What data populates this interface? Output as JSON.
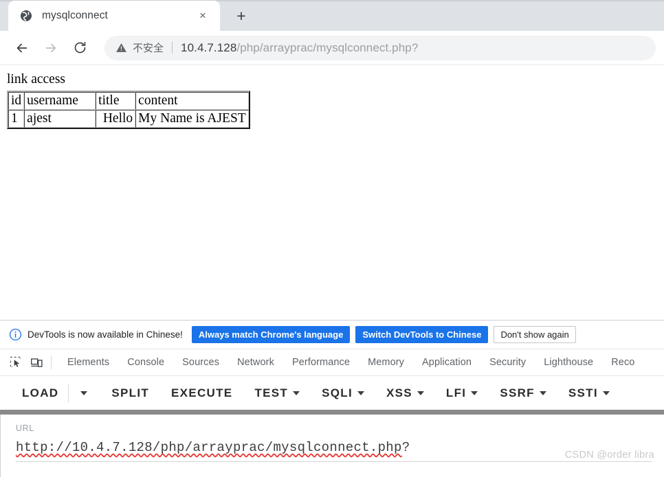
{
  "browser": {
    "tab": {
      "title": "mysqlconnect",
      "favicon": "globe-icon",
      "close_label": "×"
    },
    "newtab_label": "+",
    "nav": {
      "back": "←",
      "forward": "→",
      "reload": "reload-icon"
    },
    "omnibox": {
      "security_icon": "warning-triangle-icon",
      "security_label": "不安全",
      "url_host": "10.4.7.128",
      "url_path": "/php/arrayprac/mysqlconnect.php?"
    }
  },
  "page": {
    "heading": "link access",
    "table": {
      "headers": [
        "id",
        "username",
        "title",
        "content"
      ],
      "rows": [
        [
          "1",
          "ajest",
          "Hello",
          "My Name is AJEST"
        ]
      ]
    }
  },
  "devtools": {
    "notice": {
      "icon": "info-circle-icon",
      "text": "DevTools is now available in Chinese!",
      "buttons": [
        {
          "label": "Always match Chrome's language",
          "style": "primary"
        },
        {
          "label": "Switch DevTools to Chinese",
          "style": "primary"
        },
        {
          "label": "Don't show again",
          "style": "secondary"
        }
      ]
    },
    "icons": {
      "inspect": "inspect-element-icon",
      "device": "device-toolbar-icon"
    },
    "tabs": [
      "Elements",
      "Console",
      "Sources",
      "Network",
      "Performance",
      "Memory",
      "Application",
      "Security",
      "Lighthouse",
      "Reco"
    ]
  },
  "hackbar": {
    "toolbar": [
      {
        "label": "LOAD",
        "caret": false
      },
      {
        "label": "SPLIT",
        "caret": false
      },
      {
        "label": "EXECUTE",
        "caret": false
      },
      {
        "label": "TEST",
        "caret": true
      },
      {
        "label": "SQLI",
        "caret": true
      },
      {
        "label": "XSS",
        "caret": true
      },
      {
        "label": "LFI",
        "caret": true
      },
      {
        "label": "SSRF",
        "caret": true
      },
      {
        "label": "SSTI",
        "caret": true
      }
    ],
    "url_label": "URL",
    "url_value": "http://10.4.7.128/php/arrayprac/mysqlconnect.php?",
    "url_value_spelled": "http://10.4.7.128/php/arrayprac/mysqlconnect.php",
    "url_value_tail": "?"
  },
  "watermark": "CSDN @order libra",
  "colors": {
    "accent_blue": "#1a73e8",
    "tabstrip_bg": "#dee1e6",
    "omnibox_bg": "#f1f3f4",
    "scrollbar": "#8a8a8a"
  }
}
